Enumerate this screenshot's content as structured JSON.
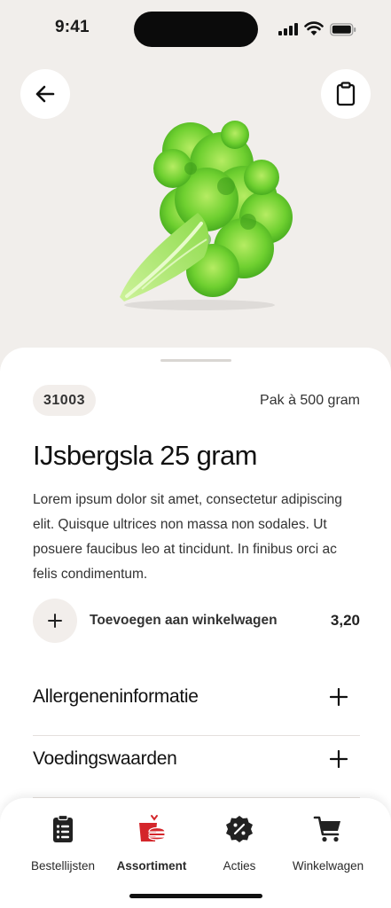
{
  "status_bar": {
    "time": "9:41"
  },
  "product": {
    "sku": "31003",
    "package": "Pak à 500 gram",
    "title": "IJsbergsla 25 gram",
    "description": "Lorem ipsum dolor sit amet, consectetur adipiscing elit. Quisque ultrices non massa non sodales. Ut posuere faucibus leo at tincidunt. In finibus orci ac felis condimentum.",
    "add_to_cart_label": "Toevoegen aan winkelwagen",
    "price": "3,20"
  },
  "sections": [
    {
      "label": "Allergeneninformatie"
    },
    {
      "label": "Voedingswaarden"
    }
  ],
  "nav": {
    "items": [
      {
        "label": "Bestellijsten",
        "icon": "clipboard-list-icon"
      },
      {
        "label": "Assortiment",
        "icon": "food-icon",
        "active": true
      },
      {
        "label": "Acties",
        "icon": "discount-badge-icon"
      },
      {
        "label": "Winkelwagen",
        "icon": "cart-icon"
      }
    ]
  },
  "colors": {
    "accent": "#d4262b",
    "background": "#f1eeeb",
    "chip": "#f2eeeb"
  }
}
